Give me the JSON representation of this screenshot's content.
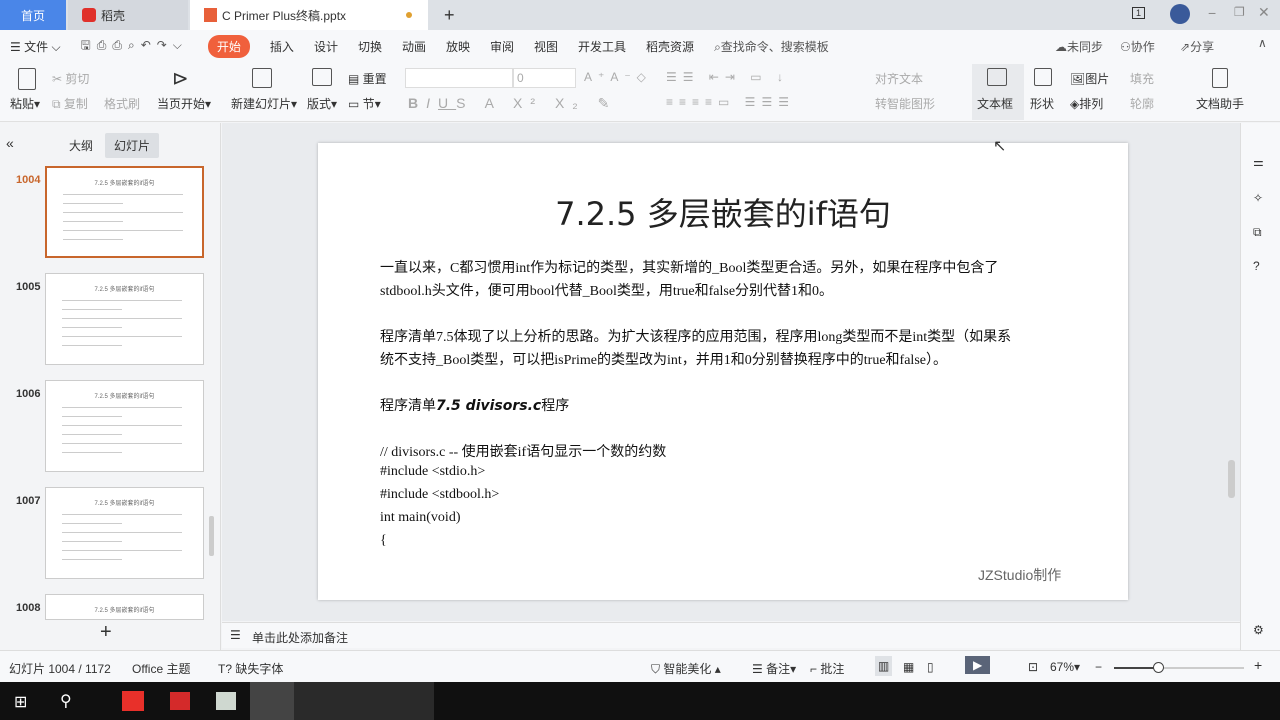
{
  "tabs": {
    "home": "首页",
    "docer": "稻壳",
    "file": "C Primer  Plus终稿.pptx",
    "new_tab": "+"
  },
  "window": {
    "badge": "1"
  },
  "menu": {
    "file": "文件",
    "items": [
      "开始",
      "插入",
      "设计",
      "切换",
      "动画",
      "放映",
      "审阅",
      "视图",
      "开发工具",
      "稻壳资源"
    ],
    "search": "查找命令、搜索模板",
    "sync": "未同步",
    "collab": "协作",
    "share": "分享"
  },
  "ribbon": {
    "paste": "粘贴",
    "cut": "剪切",
    "copy": "复制",
    "format_painter": "格式刷",
    "play_from_current": "当页开始",
    "new_slide": "新建幻灯片",
    "layout": "版式",
    "section": "节",
    "reset": "重置",
    "font_size": "0",
    "align_text": "对齐文本",
    "smartart": "转智能图形",
    "textbox": "文本框",
    "shape": "形状",
    "picture": "图片",
    "arrange": "排列",
    "fill": "填充",
    "outline": "轮廓",
    "doc_assistant": "文档助手"
  },
  "panel": {
    "outline_tab": "大纲",
    "slides_tab": "幻灯片",
    "thumbs": [
      {
        "num": "1004"
      },
      {
        "num": "1005"
      },
      {
        "num": "1006"
      },
      {
        "num": "1007"
      },
      {
        "num": "1008"
      }
    ],
    "thumb_title": "7.2.5 多层嵌套的if语句"
  },
  "slide": {
    "title": "7.2.5 多层嵌套的if语句",
    "lines": [
      "一直以来，C都习惯用int作为标记的类型，其实新增的_Bool类型更合适。另外，如果在程序中包含了",
      "stdbool.h头文件，便可用bool代替_Bool类型，用true和false分别代替1和0。",
      "程序清单7.5体现了以上分析的思路。为扩大该程序的应用范围，程序用long类型而不是int类型（如果系",
      "统不支持_Bool类型，可以把isPrime的类型改为int，并用1和0分别替换程序中的true和false）。"
    ],
    "listing_prefix": "程序清单",
    "listing_name": "7.5 divisors.c",
    "listing_suffix": "程序",
    "code": [
      "// divisors.c -- 使用嵌套if语句显示一个数的约数",
      "#include <stdio.h>",
      "#include <stdbool.h>",
      "int main(void)",
      "{"
    ],
    "watermark": "JZStudio制作"
  },
  "notes_placeholder": "单击此处添加备注",
  "status": {
    "slide": "幻灯片 1004 / 1172",
    "theme": "Office 主题",
    "missing_font": "缺失字体",
    "beautify": "智能美化",
    "notes": "备注",
    "comment": "批注",
    "zoom": "67%",
    "zoom_value": 67
  },
  "colors": {
    "accent": "#f0603c",
    "selected": "#c8662c",
    "home_tab": "#4a86e8"
  }
}
